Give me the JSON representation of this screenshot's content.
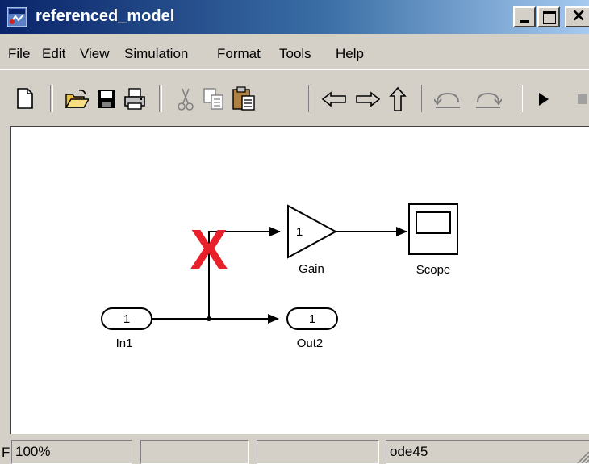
{
  "window": {
    "title": "referenced_model"
  },
  "menu": [
    "File",
    "Edit",
    "View",
    "Simulation",
    "Format",
    "Tools",
    "Help"
  ],
  "toolbar": {
    "icons": [
      "new-icon",
      "open-icon",
      "save-icon",
      "print-icon",
      "cut-icon",
      "copy-icon",
      "paste-icon",
      "back-icon",
      "forward-icon",
      "up-icon",
      "undo-icon",
      "redo-icon",
      "run-icon",
      "stop-icon"
    ]
  },
  "diagram": {
    "blocks": {
      "in1": {
        "value": "1",
        "label": "In1"
      },
      "gain": {
        "value": "1",
        "label": "Gain"
      },
      "scope": {
        "label": "Scope"
      },
      "out2": {
        "value": "1",
        "label": "Out2"
      }
    },
    "mark": {
      "text": "X",
      "color": "#e8202a"
    }
  },
  "status": {
    "cut_char": "F",
    "zoom": "100%",
    "empty1": "",
    "empty2": "",
    "solver": "ode45"
  }
}
